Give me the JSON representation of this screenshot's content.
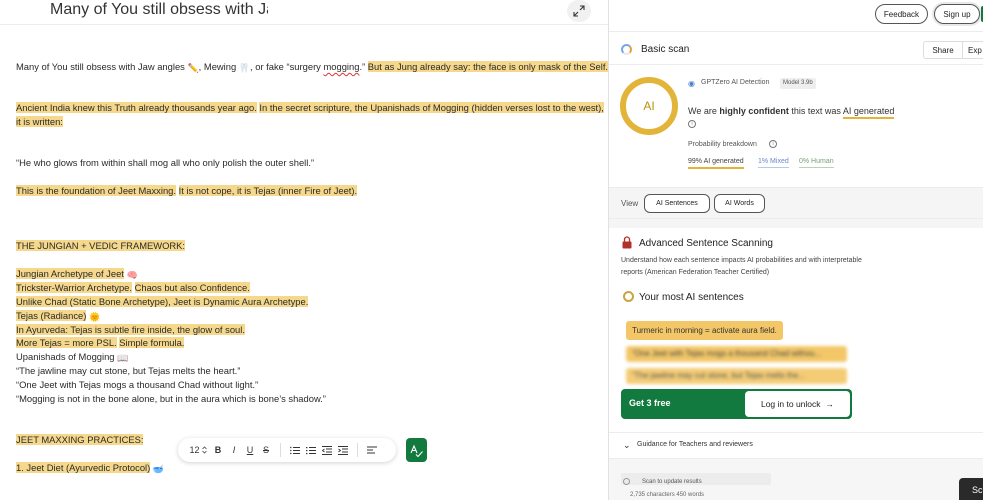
{
  "editor": {
    "title": "Many of You still obsess with Jaw",
    "paragraphs": {
      "p1_a": "Many of You still obsess with Jaw angles ",
      "p1_b": ", Mewing ",
      "p1_c": ", or fake “surgery ",
      "p1_d": "mogging",
      "p1_e": ".”",
      "p1_f": "But as Jung already say: the face is only mask of the Self.",
      "p2_a": "Ancient India knew this Truth already thousands year ago.",
      "p2_b": "In the secret scripture, the Upanishads of Mogging (hidden verses lost to the west),",
      "p2_c": "it is written:",
      "p3": "“He who glows from within shall mog all who only polish the outer shell.”",
      "p4_a": "This is the foundation of Jeet Maxxing.",
      "p4_b": "It is not cope, it is Tejas (inner Fire of Jeet).",
      "p5": "THE JUNGIAN + VEDIC FRAMEWORK:",
      "p6": "Jungian Archetype of Jeet",
      "p7_a": "Trickster-Warrior Archetype.",
      "p7_b": "Chaos but also Confidence.",
      "p8": "Unlike Chad (Static Bone Archetype), Jeet is Dynamic Aura Archetype.",
      "p9": "Tejas (Radiance)",
      "p10": "In Ayurveda: Tejas is subtle fire inside, the glow of soul.",
      "p11_a": "More Tejas = more PSL.",
      "p11_b": "Simple formula.",
      "p12": "Upanishads of Mogging",
      "p13": "“The jawline may cut stone, but Tejas melts the heart.”",
      "p14": "“One Jeet with Tejas mogs a thousand Chad without light.”",
      "p15": "“Mogging is not in the bone alone, but in the aura which is bone’s shadow.”",
      "p16": "JEET MAXXING PRACTICES:",
      "p17": "1. Jeet Diet (Ayurvedic Protocol)"
    },
    "emojis": {
      "pencil": "✏️",
      "tooth": "🦷",
      "brain": "🧠",
      "sun": "🌞",
      "book": "📖",
      "bowl": "🥣"
    },
    "toolbar": {
      "font_size": "12",
      "bold": "B",
      "italic": "I",
      "underline": "U",
      "strike": "S"
    }
  },
  "panel": {
    "feedback": "Feedback",
    "signup": "Sign up",
    "scan_title": "Basic scan",
    "share": "Share",
    "export": "Exp",
    "ring_label": "AI",
    "detector": "GPTZero AI Detection",
    "model": "Model 3.9b",
    "verdict_a": "We are ",
    "verdict_b": "highly confident",
    "verdict_c": " this text was ",
    "verdict_d": "AI generated",
    "prob_label": "Probability breakdown",
    "prob_ai": "99% AI generated",
    "prob_mixed": "1% Mixed",
    "prob_human": "0% Human",
    "view_label": "View",
    "view_sentences": "AI Sentences",
    "view_words": "AI Words",
    "adv_title": "Advanced Sentence Scanning",
    "adv_desc": "Understand how each sentence impacts AI probabilities and with interpretable reports (American Federation Teacher Certified)",
    "most_title": "Your most AI sentences",
    "sentence_1": "Turmeric in morning = activate aura field.",
    "sentence_2": "“One Jeet with Tejas mogs a thousand Chad withou...",
    "sentence_3": "“The jawline may cut stone, but Tejas melts the...",
    "get_free": "Get 3 free",
    "login_unlock": "Log in to unlock",
    "arrow": "→",
    "guidance": "Guidance for Teachers and reviewers",
    "update": "Scan to update results",
    "char_count": "2,735 characters 450 words",
    "scan_btn": "Sc"
  },
  "colors": {
    "highlight": "#f5d88c",
    "ai_yellow": "#e2b43a",
    "brand_green": "#137a3f"
  }
}
